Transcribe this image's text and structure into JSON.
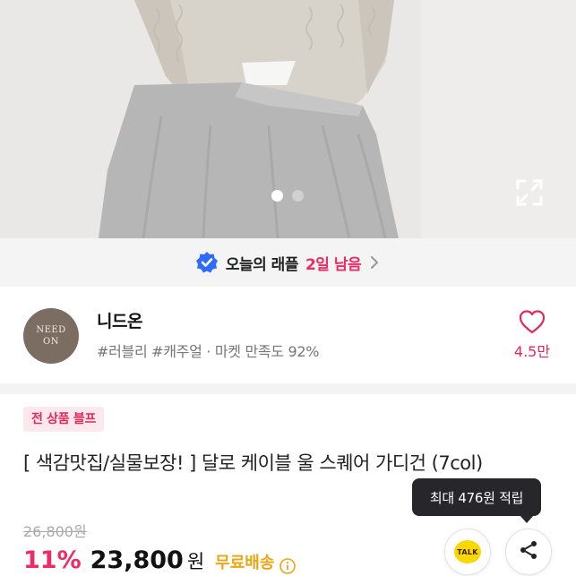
{
  "gallery": {
    "current_slide": 1,
    "total_slides": 2,
    "colors": {
      "active_dot": "#ffffff",
      "inactive_dot": "#d0d0d0"
    },
    "expand_icon": "expand-icon"
  },
  "raffle": {
    "label": "오늘의 래플",
    "days_left": "2일 남음",
    "badge_icon": "verified-check-icon",
    "chevron_icon": "chevron-right-icon",
    "accent_color": "#ee2b63",
    "badge_color": "#2f6bff"
  },
  "shop": {
    "avatar_line1": "NEED",
    "avatar_line2": "ON",
    "name": "니드온",
    "tags": "#러블리 #캐주얼 · 마켓 만족도 92%",
    "like_count": "4.5만",
    "heart_icon": "heart-icon"
  },
  "product": {
    "promo_badge": "전 상품 블프",
    "title": "[ 색감맛집/실물보장! ] 달로 케이블 울 스퀘어 가디건 (7col)",
    "original_price": "26,800원",
    "discount": "11%",
    "price": "23,800",
    "currency": "원",
    "shipping": "무료배송",
    "info_icon": "info-icon"
  },
  "tooltip": {
    "text": "최대 476원 적립"
  },
  "actions": {
    "kakao_label": "TALK",
    "kakao_icon": "kakaotalk-icon",
    "share_icon": "share-icon"
  }
}
